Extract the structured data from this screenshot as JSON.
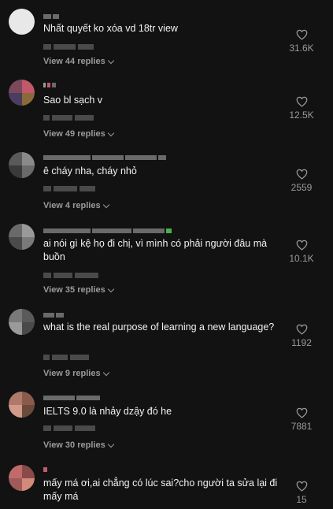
{
  "colors": {
    "background": "#121212",
    "text": "#f2f2f2",
    "muted": "#9a9a9a"
  },
  "comments": [
    {
      "text": "Nhất quyết ko xóa vd 18tr view",
      "replies": "View 44 replies",
      "likes": "31.6K"
    },
    {
      "text": "Sao bl sạch v",
      "replies": "View 49 replies",
      "likes": "12.5K"
    },
    {
      "text": "ê cháy nha, cháy nhỏ",
      "replies": "View 4 replies",
      "likes": "2559"
    },
    {
      "text": "ai nói gì kệ họ đi chị, vì mình có phải người đâu mà buồn",
      "replies": "View 35 replies",
      "likes": "10.1K"
    },
    {
      "text": "what is the real purpose of learning a new language?",
      "replies": "View 9 replies",
      "likes": "1192"
    },
    {
      "text": "IELTS 9.0 là nhảy dzậy đó he",
      "replies": "View 30 replies",
      "likes": "7881"
    },
    {
      "text": "mấy má ơi,ai chẳng có lúc sai?cho người ta sửa lại đi mấy má",
      "replies": "",
      "likes": "15"
    }
  ],
  "icons": {
    "like": "heart-outline-icon",
    "expand": "chevron-down-icon"
  }
}
